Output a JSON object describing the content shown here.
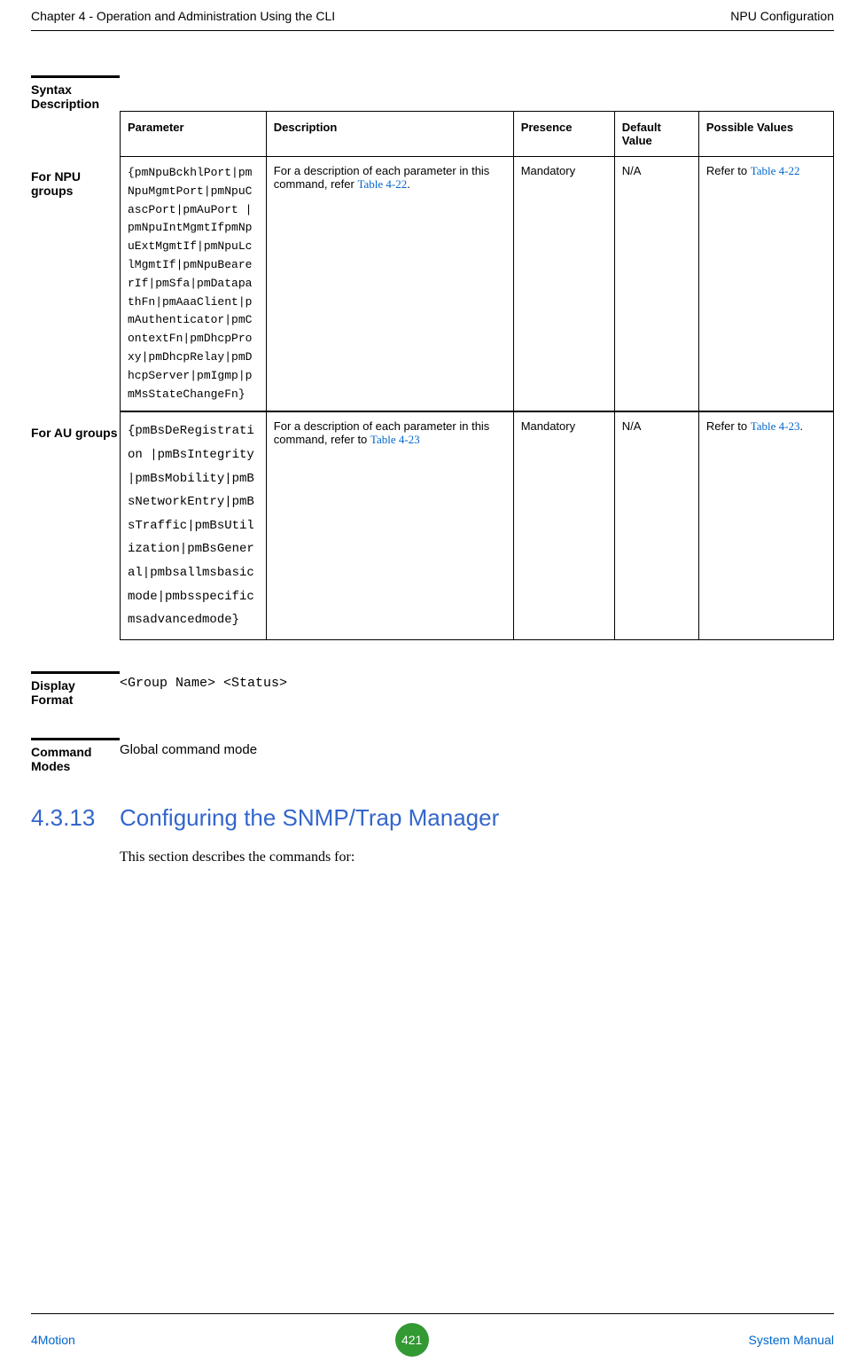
{
  "header": {
    "left": "Chapter 4 - Operation and Administration Using the CLI",
    "right": "NPU Configuration"
  },
  "syntax": {
    "label": "Syntax Description",
    "table": {
      "headers": {
        "parameter": "Parameter",
        "description": "Description",
        "presence": "Presence",
        "default": "Default Value",
        "possible": "Possible Values"
      },
      "rows": [
        {
          "rowLabel": "For NPU groups",
          "parameter": "{pmNpuBckhlPort|pmNpuMgmtPort|pmNpuCascPort|pmAuPort |pmNpuIntMgmtIfpmNpuExtMgmtIf|pmNpuLclMgmtIf|pmNpuBearerIf|pmSfa|pmDatapathFn|pmAaaClient|pmAuthenticator|pmContextFn|pmDhcpProxy|pmDhcpRelay|pmDhcpServer|pmIgmp|pmMsStateChangeFn}",
          "descriptionPrefix": "For a description of each parameter in this command, refer ",
          "descriptionLink": "Table 4-22",
          "descriptionSuffix": ".",
          "presence": "Mandatory",
          "default": "N/A",
          "possiblePrefix": "Refer to ",
          "possibleLink": "Table 4-22"
        },
        {
          "rowLabel": "For AU groups",
          "parameter": "{pmBsDeRegistration |pmBsIntegrity|pmBsMobility|pmBsNetworkEntry|pmBsTraffic|pmBsUtilization|pmBsGeneral|pmbsallmsbasicmode|pmbsspecificmsadvancedmode}",
          "descriptionPrefix": "For a description of each parameter in this command, refer to ",
          "descriptionLink": "Table 4-23",
          "descriptionSuffix": "",
          "presence": "Mandatory",
          "default": "N/A",
          "possiblePrefix": "Refer to ",
          "possibleLink": "Table 4-23",
          "possibleSuffix": "."
        }
      ]
    }
  },
  "displayFormat": {
    "label": "Display Format",
    "content": "<Group Name>   <Status>"
  },
  "commandModes": {
    "label": "Command Modes",
    "content": "Global command mode"
  },
  "sectionHeading": {
    "number": "4.3.13",
    "title": "Configuring the SNMP/Trap Manager"
  },
  "bodyText": "This section describes the commands for:",
  "footer": {
    "left": "4Motion",
    "center": "421",
    "right": "System Manual"
  }
}
